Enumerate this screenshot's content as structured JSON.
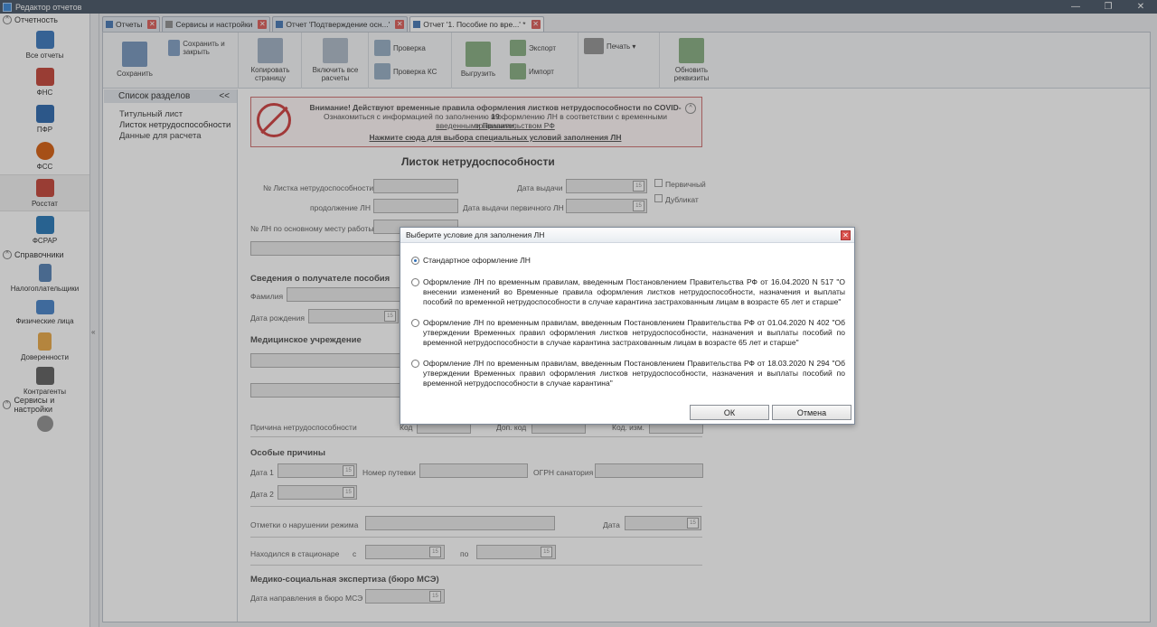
{
  "window": {
    "title": "Редактор отчетов",
    "min": "—",
    "max": "❐",
    "close": "✕"
  },
  "nav": {
    "group_reports": "Отчетность",
    "items": [
      {
        "label": "Все отчеты",
        "icon": "all-reports-icon",
        "color": "#2f6fb8"
      },
      {
        "label": "ФНС",
        "icon": "fns-icon",
        "color": "#c0392b"
      },
      {
        "label": "ПФР",
        "icon": "pfr-icon",
        "color": "#1f5fa8"
      },
      {
        "label": "ФСС",
        "icon": "fss-icon",
        "color": "#d35400"
      },
      {
        "label": "Росстат",
        "icon": "rosstat-icon",
        "color": "#c0392b"
      },
      {
        "label": "ФСРАР",
        "icon": "fsrar-icon",
        "color": "#1a6fb3"
      }
    ],
    "group_refs": "Справочники",
    "ref_items": [
      {
        "label": "Налогоплательщики",
        "icon": "taxpayers-icon",
        "color": "#4a79b0"
      },
      {
        "label": "Физические лица",
        "icon": "persons-icon",
        "color": "#3b7bc4"
      },
      {
        "label": "Доверенности",
        "icon": "power-of-attorney-icon",
        "color": "#e8a23a"
      },
      {
        "label": "Контрагенты",
        "icon": "counterparties-icon",
        "color": "#555555"
      }
    ],
    "group_services": "Сервисы и настройки"
  },
  "tabs": [
    {
      "label": "Отчеты"
    },
    {
      "label": "Сервисы и настройки"
    },
    {
      "label": "Отчет 'Подтверждение осн...'"
    },
    {
      "label": "Отчет '1. Пособие по вре...' *"
    }
  ],
  "ribbon": {
    "save": "Сохранить",
    "save_close": "Сохранить и закрыть",
    "copy_page": "Копировать страницу",
    "include_calc": "Включить все расчеты",
    "check": "Проверка",
    "check_ks": "Проверка КС",
    "export_big": "Выгрузить",
    "export": "Экспорт",
    "import": "Импорт",
    "print": "Печать ▾",
    "update": "Обновить реквизиты"
  },
  "sections": {
    "header": "Список разделов",
    "collapse": "<<",
    "items": [
      "Титульный лист",
      "Листок нетрудоспособности",
      "Данные для расчета"
    ]
  },
  "banner": {
    "line1": "Внимание! Действуют временные правила оформления листков нетрудоспособности по COVID-19",
    "line2": "Ознакомиться с информацией по заполнению и оформлению ЛН в соответствии с временными правилами,",
    "line3": "введенными Правительством РФ",
    "line4": "Нажмите сюда для выбора специальных условий заполнения ЛН",
    "collapse": "^"
  },
  "form": {
    "title": "Листок нетрудоспособности",
    "ln_number": "№ Листка нетрудоспособности",
    "issue_date": "Дата выдачи",
    "primary": "Первичный",
    "duplicate": "Дубликат",
    "continuation": "продолжение ЛН №",
    "primary_issue_date": "Дата выдачи первичного ЛН",
    "main_job_ln": "№ ЛН по основному месту работы",
    "recipient": "Сведения о получателе пособия",
    "surname": "Фамилия",
    "birth_date": "Дата рождения",
    "medical": "Медицинское учреждение",
    "reason": "Причина нетрудоспособности",
    "code": "Код",
    "extra_code": "Доп. код",
    "change_code": "Код. изм.",
    "special": "Особые причины",
    "date1": "Дата 1",
    "date2": "Дата 2",
    "voucher": "Номер путевки",
    "ogrn": "ОГРН санатория",
    "violation": "Отметки о нарушении режима",
    "date": "Дата",
    "hospital": "Находился в стационаре",
    "from": "с",
    "to": "по",
    "mse": "Медико-социальная экспертиза (бюро МСЭ)",
    "mse_date": "Дата направления в бюро МСЭ"
  },
  "dialog": {
    "title": "Выберите условие для заполнения ЛН",
    "close": "✕",
    "options": [
      "Стандартное оформление ЛН",
      "Оформление ЛН по временным правилам, введенным Постановлением Правительства РФ от 16.04.2020 N 517 \"О внесении изменений во Временные правила оформления листков нетрудоспособности, назначения и выплаты пособий по временной нетрудоспособности в случае карантина застрахованным лицам в возрасте 65 лет и старше\"",
      "Оформление ЛН по временным правилам, введенным Постановлением Правительства РФ от 01.04.2020 N 402 \"Об утверждении Временных правил оформления листков нетрудоспособности, назначения и выплаты пособий по временной нетрудоспособности в случае карантина застрахованным лицам в возрасте 65 лет и старше\"",
      "Оформление ЛН по временным правилам, введенным Постановлением Правительства РФ от 18.03.2020 N 294 \"Об утверждении Временных правил оформления листков нетрудоспособности, назначения и выплаты пособий по временной нетрудоспособности в случае карантина\""
    ],
    "selected_index": 0,
    "ok": "ОК",
    "cancel": "Отмена"
  }
}
